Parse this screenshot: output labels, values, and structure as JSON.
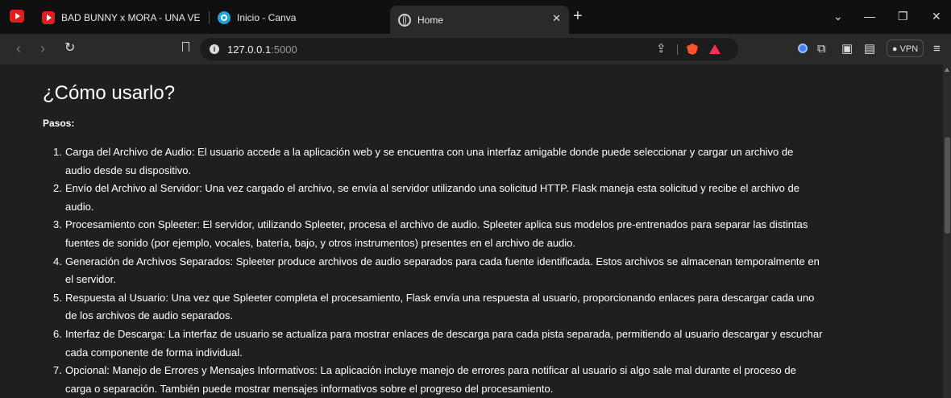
{
  "browser": {
    "tabs": [
      {
        "title": "BAD BUNNY x MORA - UNA VEZ | Yt",
        "favicon": "youtube-icon",
        "active": false
      },
      {
        "title": "Inicio - Canva",
        "favicon": "canva-icon",
        "active": false
      },
      {
        "title": "Home",
        "favicon": "globe-icon",
        "active": true
      }
    ],
    "new_tab_glyph": "+",
    "tab_close_glyph": "✕",
    "window_controls": {
      "dropdown": "⌄",
      "minimize": "—",
      "restore": "❐",
      "close": "✕"
    },
    "url_host": "127.0.0.1",
    "url_port": ":5000",
    "vpn_label": "VPN",
    "colors": {
      "tabstrip": "#101010",
      "toolbar": "#2a2a2a",
      "page_bg": "#1f1f1f",
      "brave": "#fb542b"
    }
  },
  "page": {
    "title": "¿Cómo usarlo?",
    "steps_label": "Pasos:",
    "steps": [
      {
        "num": "1.",
        "line1": "Carga del Archivo de Audio: El usuario accede a la aplicación web y se encuentra con una interfaz amigable donde puede seleccionar y cargar un archivo de",
        "line2": "audio desde su dispositivo."
      },
      {
        "num": "2.",
        "line1": "Envío del Archivo al Servidor: Una vez cargado el archivo, se envía al servidor utilizando una solicitud HTTP. Flask maneja esta solicitud y recibe el archivo de",
        "line2": "audio."
      },
      {
        "num": "3.",
        "line1": "Procesamiento con Spleeter: El servidor, utilizando Spleeter, procesa el archivo de audio. Spleeter aplica sus modelos pre-entrenados para separar las distintas",
        "line2": "fuentes de sonido (por ejemplo, vocales, batería, bajo, y otros instrumentos) presentes en el archivo de audio."
      },
      {
        "num": "4.",
        "line1": "Generación de Archivos Separados: Spleeter produce archivos de audio separados para cada fuente identificada. Estos archivos se almacenan temporalmente en",
        "line2": "el servidor."
      },
      {
        "num": "5.",
        "line1": "Respuesta al Usuario: Una vez que Spleeter completa el procesamiento, Flask envía una respuesta al usuario, proporcionando enlaces para descargar cada uno",
        "line2": "de los archivos de audio separados."
      },
      {
        "num": "6.",
        "line1": "Interfaz de Descarga: La interfaz de usuario se actualiza para mostrar enlaces de descarga para cada pista separada, permitiendo al usuario descargar y escuchar",
        "line2": "cada componente de forma individual."
      },
      {
        "num": "7.",
        "line1": "Opcional: Manejo de Errores y Mensajes Informativos: La aplicación incluye manejo de errores para notificar al usuario si algo sale mal durante el proceso de",
        "line2": "carga o separación. También puede mostrar mensajes informativos sobre el progreso del procesamiento."
      }
    ]
  }
}
